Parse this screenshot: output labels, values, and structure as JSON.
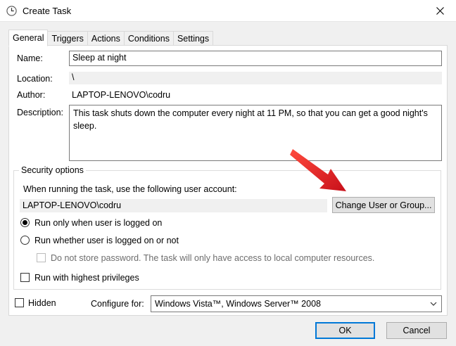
{
  "window": {
    "title": "Create Task"
  },
  "tabs": [
    {
      "label": "General",
      "active": true
    },
    {
      "label": "Triggers"
    },
    {
      "label": "Actions"
    },
    {
      "label": "Conditions"
    },
    {
      "label": "Settings"
    }
  ],
  "general": {
    "name_label": "Name:",
    "name_value": "Sleep at night",
    "location_label": "Location:",
    "location_value": "\\",
    "author_label": "Author:",
    "author_value": "LAPTOP-LENOVO\\codru",
    "description_label": "Description:",
    "description_value": "This task shuts down the computer every night at 11 PM, so that you can get a good night's sleep."
  },
  "security": {
    "title": "Security options",
    "account_prompt": "When running the task, use the following user account:",
    "account_value": "LAPTOP-LENOVO\\codru",
    "change_button": "Change User or Group...",
    "radio_logged_on": "Run only when user is logged on",
    "radio_whether": "Run whether user is logged on or not",
    "no_store_password": "Do not store password.  The task will only have access to local computer resources.",
    "highest_privileges": "Run with highest privileges"
  },
  "bottom": {
    "hidden_label": "Hidden",
    "configure_label": "Configure for:",
    "configure_value": "Windows Vista™, Windows Server™ 2008"
  },
  "buttons": {
    "ok": "OK",
    "cancel": "Cancel"
  },
  "colors": {
    "accent": "#0078d7",
    "annotation_arrow": "#e8191c"
  }
}
